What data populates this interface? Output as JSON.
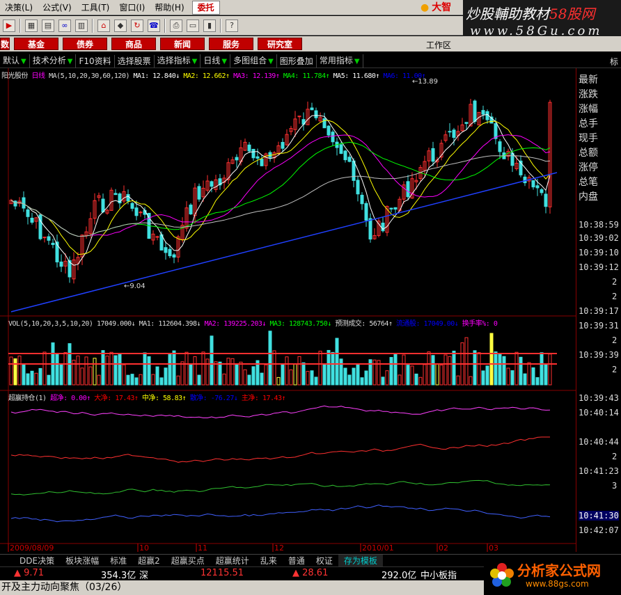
{
  "menubar": {
    "items": [
      "决策(L)",
      "公式(V)",
      "工具(T)",
      "窗口(I)",
      "帮助(H)",
      "委托"
    ],
    "brand": "大智"
  },
  "watermark": {
    "line1a": "炒股輔助教材",
    "line1b": "58股网",
    "line2": "www.58Gu.com"
  },
  "funcbar": {
    "buttons": [
      "数",
      "基金",
      "债券",
      "商品",
      "新闻",
      "服务",
      "研究室"
    ],
    "workspace": "工作区"
  },
  "tabs": {
    "items": [
      "默认",
      "技术分析",
      "F10资料",
      "选择股票",
      "选择指标",
      "日线",
      "多图组合",
      "图形叠加",
      "常用指标"
    ],
    "right": "标"
  },
  "chart": {
    "stock_name": "阳光股份",
    "period": "日线",
    "ma_label": "MA(5,10,20,30,60,120)",
    "ma1": "MA1: 12.840↓",
    "ma2": "MA2: 12.662↑",
    "ma3": "MA3: 12.139↑",
    "ma4": "MA4: 11.784↑",
    "ma5": "MA5: 11.680↑",
    "ma6": "MA6: 11.00↑",
    "high_label": "13.89",
    "low_label": "9.04",
    "vol_label": "VOL(5,10,20,3,5,10,20)",
    "vol_val": "17049.000↓",
    "vol_ma1": "MA1: 112604.398↓",
    "vol_ma2": "MA2: 139225.203↓",
    "vol_ma3": "MA3: 128743.750↓",
    "vol_pred": "预测成交: 56764↑",
    "vol_ltp": "流通股: 17049.00↓",
    "vol_turn": "换手率%: 0",
    "cy_label": "超赢持仓(1)",
    "cy_super": "超净: 0.00↑",
    "cy_big": "大净: 17.43↑",
    "cy_mid": "中净: 58.83↑",
    "cy_small": "散净: -76.27↓",
    "cy_main": "主净: 17.43↑",
    "x_labels": [
      "2009/08/09",
      "10",
      "11",
      "12",
      "2010/01",
      "02",
      "03"
    ]
  },
  "rightpanel": {
    "items": [
      "最新",
      "涨跌",
      "涨幅",
      "总手",
      "现手",
      "总额",
      "涨停",
      "总笔",
      "内盘"
    ],
    "times": [
      "10:38:59",
      "10:39:02",
      "10:39:10",
      "10:39:12",
      "2",
      "2",
      "10:39:17",
      "10:39:31",
      "2",
      "10:39:39",
      "2",
      "10:39:43",
      "10:40:14",
      "10:40:44",
      "2",
      "10:41:23",
      "3",
      "10:41:30",
      "10:42:07"
    ]
  },
  "bottomtabs": {
    "items": [
      "DDE决策",
      "板块涨幅",
      "标准",
      "超赢2",
      "超赢买点",
      "超赢统计",
      "乱来",
      "普通",
      "权证",
      "存为模板"
    ]
  },
  "statusbar": {
    "change1": "▲ 9.71",
    "amount1": "354.3亿",
    "market1": "深",
    "index2": "12115.51",
    "change2": "▲ 28.61",
    "amount2": "292.0亿",
    "market2": "中小板指"
  },
  "bottomline": "开及主力动向聚焦（03/26）",
  "logo": {
    "title": "分析家公式网",
    "url": "www.88gs.com"
  }
}
